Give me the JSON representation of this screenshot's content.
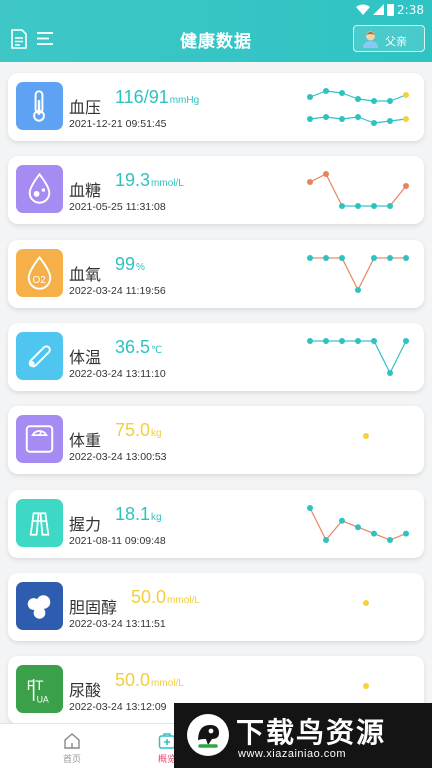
{
  "status_bar": {
    "time": "2:38"
  },
  "header": {
    "title": "健康数据",
    "profile_label": "父亲"
  },
  "metrics": [
    {
      "name": "血压",
      "value": "116/91",
      "unit": "mmHg",
      "date": "2021-12-21 09:51:45",
      "value_color": "#2ec2c1",
      "icon": "thermometer-icon",
      "icon_color": "#5ea3f3",
      "chart": {
        "series": [
          {
            "values": [
              95,
              98,
              97,
              94,
              93,
              93,
              96
            ],
            "line_color": "#2ec2c1",
            "point_color": "#2ec2c1",
            "last_point_color": "#f5d23a"
          },
          {
            "values": [
              84,
              85,
              84,
              85,
              82,
              83,
              84
            ],
            "line_color": "#2ec2c1",
            "point_color": "#2ec2c1",
            "last_point_color": "#f5d23a"
          }
        ]
      }
    },
    {
      "name": "血糖",
      "value": "19.3",
      "unit": "mmol/L",
      "date": "2021-05-25 11:31:08",
      "value_color": "#2ec2c1",
      "icon": "blood-drop-icon",
      "icon_color": "#a68bf2",
      "chart": {
        "series": [
          {
            "values": [
              14,
              16,
              8,
              8,
              8,
              8,
              13
            ],
            "point_colors": [
              "#e8845c",
              "#e8845c",
              "#2ec2c1",
              "#2ec2c1",
              "#2ec2c1",
              "#2ec2c1",
              "#e8845c"
            ],
            "line_color_high": "#e8845c",
            "line_color": "#2ec2c1"
          }
        ]
      }
    },
    {
      "name": "血氧",
      "value": "99",
      "unit": "%",
      "date": "2022-03-24 11:19:56",
      "value_color": "#2ec2c1",
      "icon": "o2-drop-icon",
      "icon_color": "#f5b04a",
      "chart": {
        "series": [
          {
            "values": [
              98,
              98,
              98,
              97,
              98,
              98,
              98
            ],
            "line_color": "#e8845c",
            "point_color": "#2ec2c1"
          }
        ]
      }
    },
    {
      "name": "体温",
      "value": "36.5",
      "unit": "℃",
      "date": "2022-03-24 13:11:10",
      "value_color": "#2ec2c1",
      "icon": "digital-thermometer-icon",
      "icon_color": "#4fc6ef",
      "chart": {
        "series": [
          {
            "values": [
              36.5,
              36.5,
              36.5,
              36.5,
              36.5,
              35.8,
              36.5
            ],
            "line_color": "#2ec2c1",
            "point_color": "#2ec2c1"
          }
        ]
      }
    },
    {
      "name": "体重",
      "value": "75.0",
      "unit": "kg",
      "date": "2022-03-24 13:00:53",
      "value_color": "#f2cf3c",
      "icon": "scale-icon",
      "icon_color": "#a68bf2",
      "chart": {
        "single_point_color": "#f5d23a"
      }
    },
    {
      "name": "握力",
      "value": "18.1",
      "unit": "kg",
      "date": "2021-08-11 09:09:48",
      "value_color": "#2ec2c1",
      "icon": "grip-icon",
      "icon_color": "#3dd9c4",
      "chart": {
        "series": [
          {
            "values": [
              18.4,
              17.9,
              18.2,
              18.1,
              18.0,
              17.9,
              18.0
            ],
            "line_color": "#e8845c",
            "point_color": "#2ec2c1"
          }
        ]
      }
    },
    {
      "name": "胆固醇",
      "value": "50.0",
      "unit": "mmol/L",
      "date": "2022-03-24 13:11:51",
      "value_color": "#f2cf3c",
      "icon": "cholesterol-icon",
      "icon_color": "#2e5db0",
      "chart": {
        "single_point_color": "#f5d23a"
      }
    },
    {
      "name": "尿酸",
      "value": "50.0",
      "unit": "mmol/L",
      "date": "2022-03-24 13:12:09",
      "value_color": "#f2cf3c",
      "icon": "uric-acid-icon",
      "icon_color": "#3aa04a",
      "chart": {
        "single_point_color": "#f5d23a"
      }
    }
  ],
  "tabbar": {
    "tabs": [
      {
        "label": "首页"
      },
      {
        "label": "概览"
      }
    ]
  },
  "watermark": {
    "title": "下载鸟资源",
    "url": "www.xiazainiao.com"
  }
}
